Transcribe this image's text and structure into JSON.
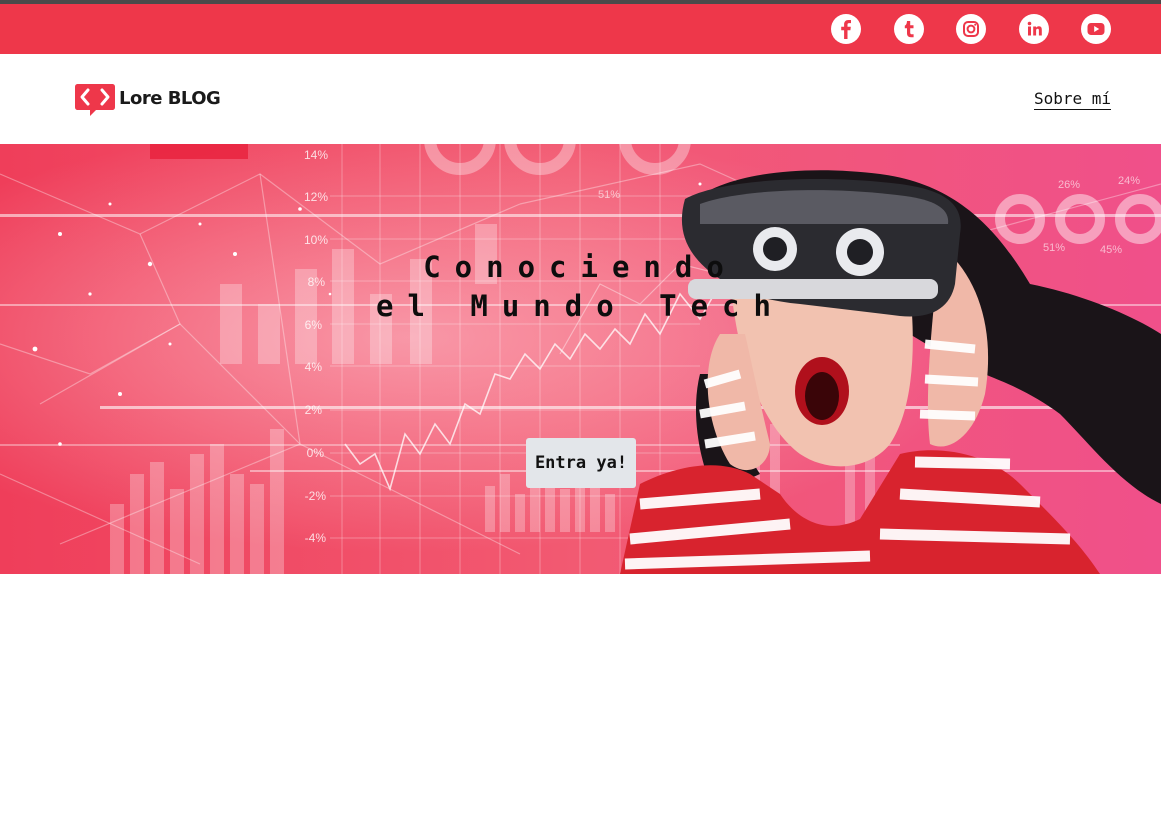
{
  "social": {
    "icons": [
      {
        "name": "facebook-icon",
        "glyph": "f"
      },
      {
        "name": "tumblr-icon",
        "glyph": "t"
      },
      {
        "name": "instagram-icon",
        "glyph": ""
      },
      {
        "name": "linkedin-icon",
        "glyph": "in"
      },
      {
        "name": "youtube-icon",
        "glyph": ""
      }
    ],
    "bar_color": "#ee374a"
  },
  "nav": {
    "logo_text": "Lore BLOG",
    "about_link": "Sobre mí"
  },
  "hero": {
    "title_line1": "Conociendo",
    "title_line2": "el Mundo Tech",
    "cta_label": "Entra ya!",
    "chart_labels": [
      "14%",
      "12%",
      "10%",
      "8%",
      "6%",
      "4%",
      "2%",
      "0%",
      "-2%",
      "-4%",
      "51%",
      "26%",
      "24%",
      "51%",
      "45%"
    ]
  },
  "colors": {
    "accent": "#ee374a",
    "button_bg": "#e3e6ea"
  }
}
